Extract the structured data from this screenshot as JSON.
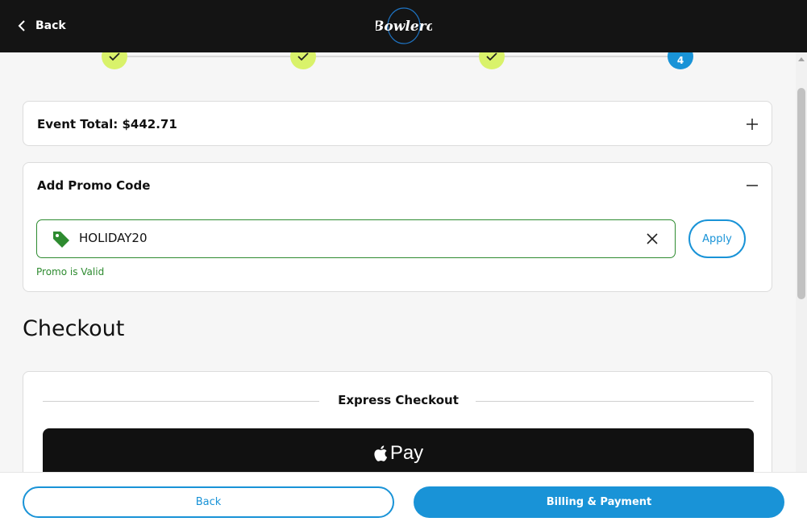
{
  "header": {
    "back_label": "Back",
    "logo_text": "Bowlero"
  },
  "stepper": {
    "steps": [
      {
        "state": "done",
        "label": ""
      },
      {
        "state": "done",
        "label": ""
      },
      {
        "state": "done",
        "label": ""
      },
      {
        "state": "current",
        "label": "4"
      }
    ],
    "done_color": "#d9f26a",
    "current_color": "#1993d7"
  },
  "event_total": {
    "title": "Event Total: $442.71",
    "toggle_icon": "plus-icon"
  },
  "promo": {
    "title": "Add Promo Code",
    "toggle_icon": "minus-icon",
    "input_value": "HOLIDAY20",
    "apply_label": "Apply",
    "status_text": "Promo is Valid",
    "valid_color": "#2e8b30"
  },
  "checkout": {
    "heading": "Checkout",
    "express_label": "Express Checkout",
    "applepay_text": "Pay"
  },
  "footer": {
    "back_label": "Back",
    "next_label": "Billing & Payment"
  },
  "colors": {
    "accent": "#1993d7",
    "header_bg": "#141414"
  }
}
